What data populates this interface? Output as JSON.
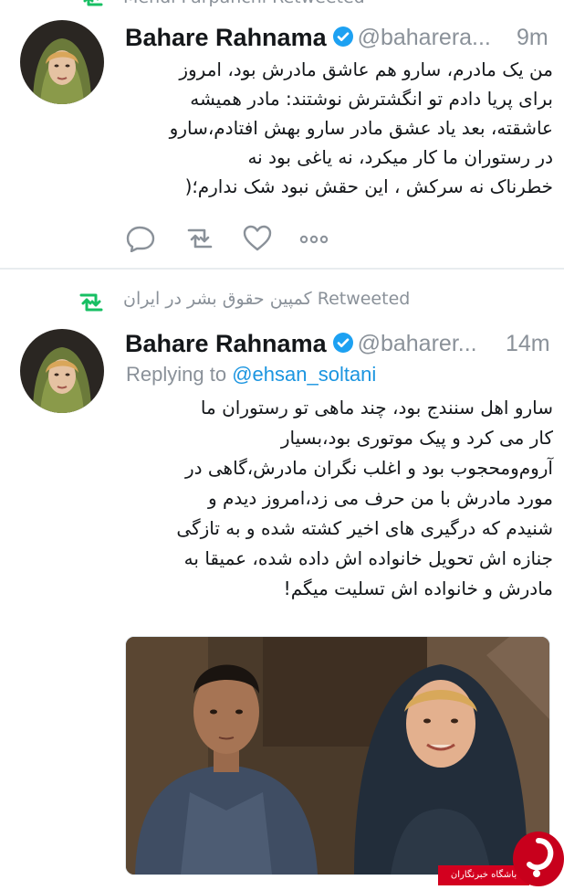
{
  "top_partial": {
    "retweet_label": "Mehdi Parpanchi Retweeted"
  },
  "tweet1": {
    "display_name": "Bahare Rahnama",
    "handle": "@baharera...",
    "time": "9m",
    "text_lines": [
      "من یک مادرم، سارو هم عاشق مادرش بود، امروز",
      "برای پریا دادم تو انگشترش نوشتند: مادر همیشه",
      "عاشقته، بعد یاد عشق مادر سارو بهش افتادم،سارو",
      "در رستوران ما کار میکرد، نه یاغی بود نه",
      "خطرناک نه سرکش ، این حقش نبود شک ندارم؛("
    ]
  },
  "tweet2": {
    "retweet_by": "کمپین حقوق بشر در ایران",
    "retweet_suffix": "Retweeted",
    "display_name": "Bahare Rahnama",
    "handle": "@baharer...",
    "time": "14m",
    "replying_label": "Replying to",
    "replying_to": "@ehsan_soltani",
    "text_lines": [
      "سارو اهل سنندج بود، چند ماهی تو رستوران ما",
      "کار می کرد و پیک موتوری بود،بسیار",
      "آروم‌ومحجوب بود و اغلب نگران مادرش،گاهی در",
      "مورد مادرش با من حرف می زد،امروز دیدم و",
      "شنیدم که درگیری های اخیر کشته شده و به تازگی",
      "جنازه اش تحویل خانواده اش داده شده، عمیقا به",
      "مادرش و خانواده اش تسلیت میگم!"
    ]
  },
  "watermark": {
    "text": "باشگاه خبرنگاران"
  },
  "colors": {
    "text": "#14171a",
    "muted": "#8a9199",
    "link": "#1b95e0",
    "verified": "#1da1f2",
    "retweet_green": "#17bf63",
    "divider": "#e8ecef"
  },
  "icons": [
    "retweet-icon",
    "verified-badge-icon",
    "reply-icon",
    "like-icon",
    "more-icon"
  ]
}
